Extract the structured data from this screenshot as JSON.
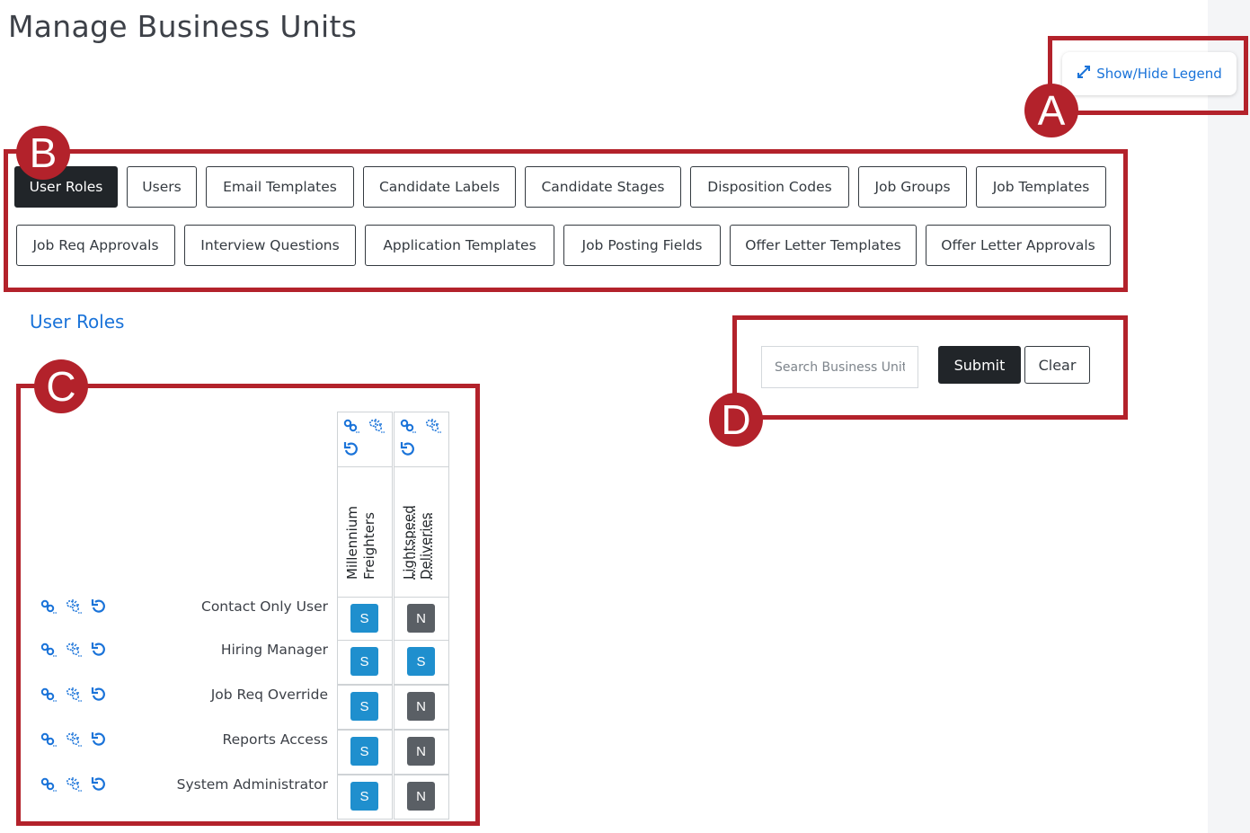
{
  "page": {
    "title": "Manage Business Units"
  },
  "legend": {
    "label": "Show/Hide Legend"
  },
  "callouts": [
    "A",
    "B",
    "C",
    "D"
  ],
  "tabs": [
    {
      "label": "User Roles",
      "active": true
    },
    {
      "label": "Users"
    },
    {
      "label": "Email Templates"
    },
    {
      "label": "Candidate Labels"
    },
    {
      "label": "Candidate Stages"
    },
    {
      "label": "Disposition Codes"
    },
    {
      "label": "Job Groups"
    },
    {
      "label": "Job Templates"
    },
    {
      "label": "Job Req Approvals"
    },
    {
      "label": "Interview Questions"
    },
    {
      "label": "Application Templates"
    },
    {
      "label": "Job Posting Fields"
    },
    {
      "label": "Offer Letter Templates"
    },
    {
      "label": "Offer Letter Approvals"
    }
  ],
  "section": {
    "title": "User Roles"
  },
  "search": {
    "placeholder": "Search Business Units",
    "submit_label": "Submit",
    "clear_label": "Clear"
  },
  "matrix": {
    "icons": [
      "link-icon",
      "unlink-icon",
      "reset-icon"
    ],
    "columns": [
      {
        "line1": "Millennium",
        "line2": "Freighters"
      },
      {
        "line1": "Lightspeed",
        "line2": "Deliveries"
      }
    ],
    "rows": [
      {
        "label": "Contact Only User",
        "values": [
          "S",
          "N"
        ]
      },
      {
        "label": "Hiring Manager",
        "values": [
          "S",
          "S"
        ]
      },
      {
        "label": "Job Req Override",
        "values": [
          "S",
          "N"
        ]
      },
      {
        "label": "Reports Access",
        "values": [
          "S",
          "N"
        ]
      },
      {
        "label": "System Administrator",
        "values": [
          "S",
          "N"
        ]
      }
    ]
  },
  "colors": {
    "accent": "#1a73d9",
    "callout": "#b3222b",
    "perm_s": "#1f8fce",
    "perm_n": "#5a5f65",
    "dark": "#212529"
  }
}
